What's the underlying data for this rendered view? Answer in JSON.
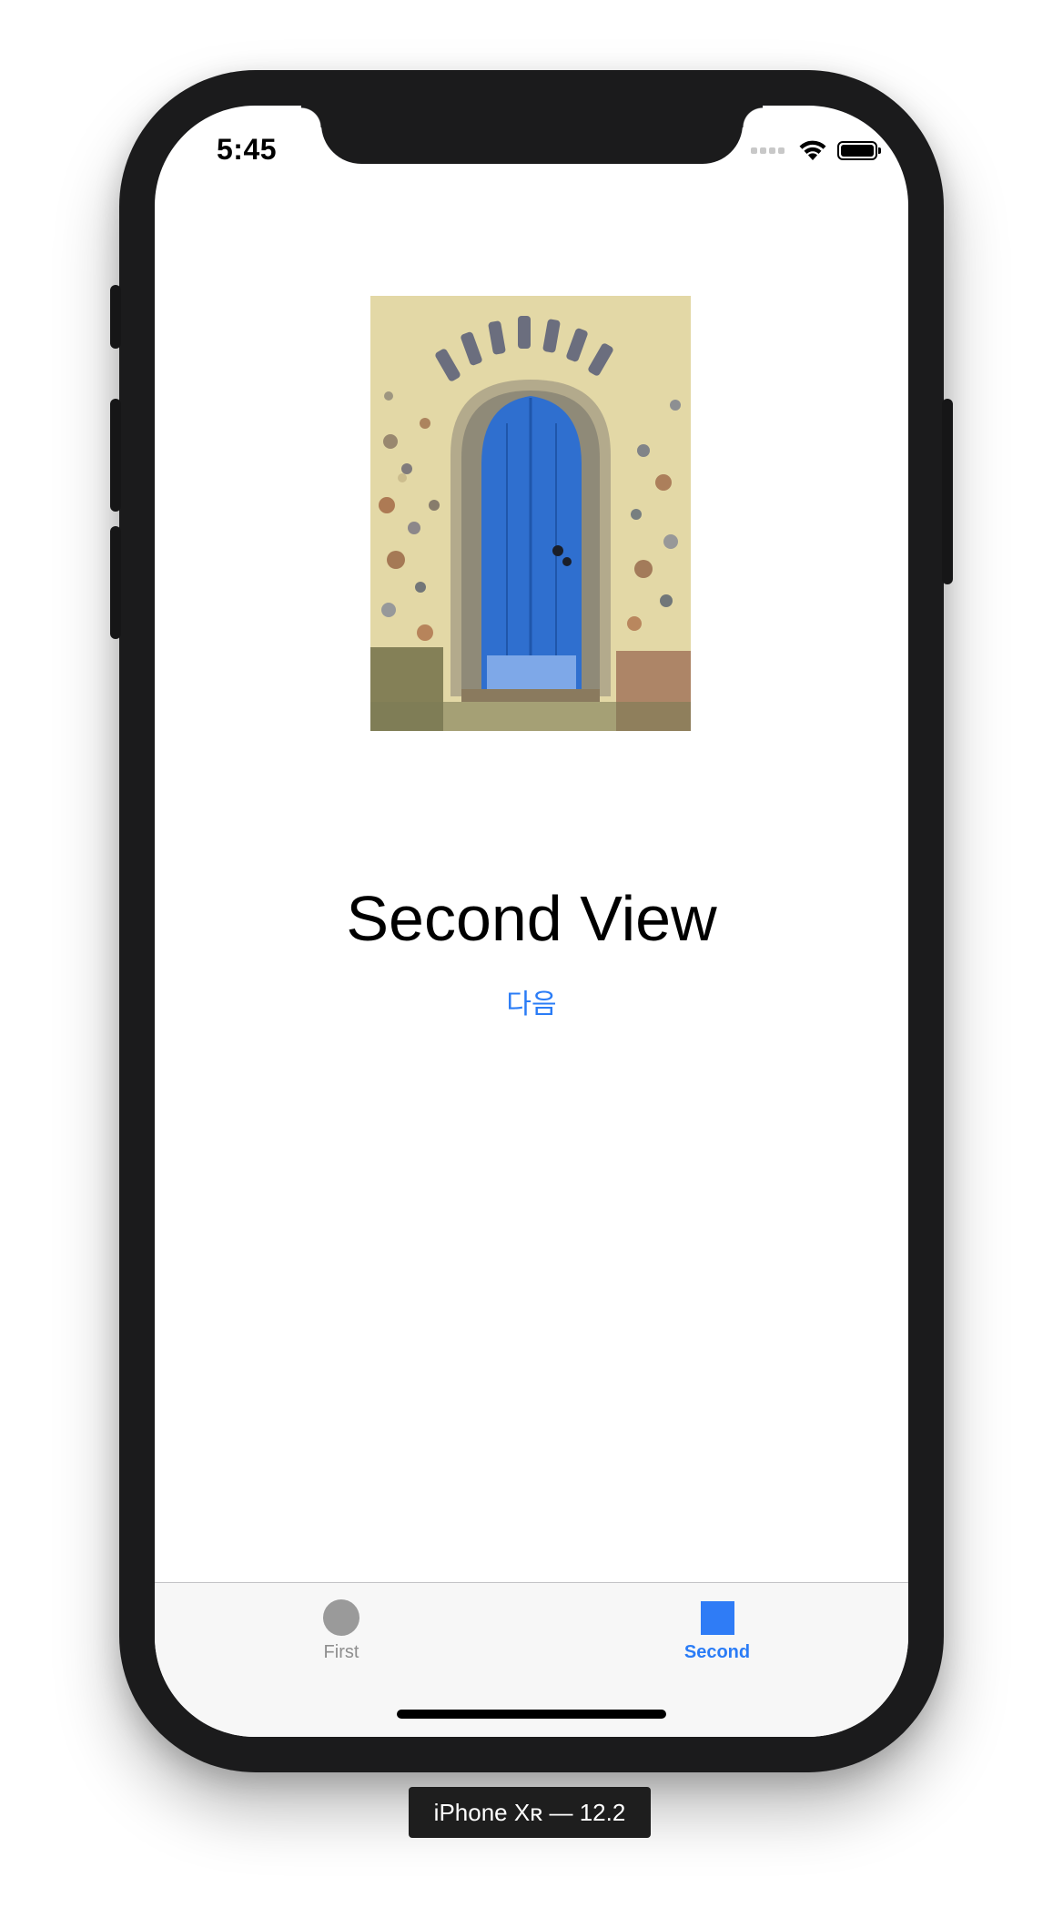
{
  "status_bar": {
    "time": "5:45",
    "icons": [
      "cellular-signal-icon",
      "wifi-icon",
      "battery-icon"
    ]
  },
  "main": {
    "image": "blue arched wooden door in flint stone wall",
    "title": "Second View",
    "next_button_label": "다음"
  },
  "tab_bar": {
    "tabs": [
      {
        "label": "First",
        "icon": "circle-icon",
        "selected": false
      },
      {
        "label": "Second",
        "icon": "square-icon",
        "selected": true
      }
    ]
  },
  "device": {
    "label": "iPhone Xʀ — 12.2"
  },
  "colors": {
    "accent": "#2a7cf6",
    "tab_inactive": "#8e8e8e",
    "device_frame": "#1b1b1c",
    "tab_bar_bg": "#f7f7f7"
  }
}
